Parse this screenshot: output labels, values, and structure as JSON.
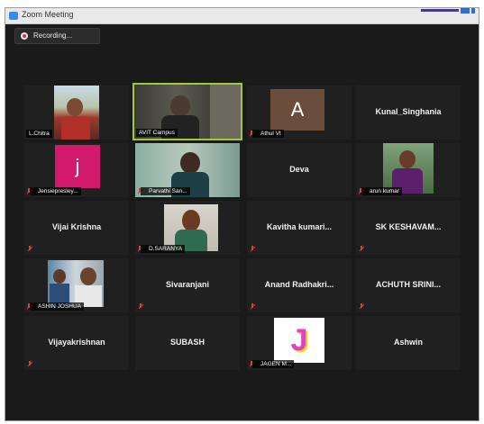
{
  "window": {
    "title": "Zoom Meeting"
  },
  "recording": {
    "label": "Recording..."
  },
  "participants": [
    {
      "name": "L.Chitra",
      "kind": "video"
    },
    {
      "name": "AVIT Campus",
      "kind": "video",
      "active": true
    },
    {
      "name": "Athul Vt",
      "kind": "letter",
      "letter": "A",
      "letter_bg": "#6a4d3b"
    },
    {
      "name": "Kunal_Singhania",
      "kind": "name"
    },
    {
      "name": "Jensiepresley...",
      "kind": "letter",
      "letter": "j",
      "letter_bg": "#d11a6b"
    },
    {
      "name": "Parvathi San...",
      "kind": "video"
    },
    {
      "name": "Deva",
      "kind": "name"
    },
    {
      "name": "arun kumar",
      "kind": "video"
    },
    {
      "name": "Vijai Krishna",
      "kind": "name"
    },
    {
      "name": "D.SARANYA",
      "kind": "video"
    },
    {
      "name": "Kavitha kumari...",
      "kind": "name"
    },
    {
      "name": "SK KESHAVAM...",
      "kind": "name"
    },
    {
      "name": "ASHIN JOSHUA",
      "kind": "video"
    },
    {
      "name": "Sivaranjani",
      "kind": "name"
    },
    {
      "name": "Anand Radhakri...",
      "kind": "name"
    },
    {
      "name": "ACHUTH SRINI...",
      "kind": "name"
    },
    {
      "name": "Vijayakrishnan",
      "kind": "name"
    },
    {
      "name": "SUBASH",
      "kind": "name"
    },
    {
      "name": "JAGEN M...",
      "kind": "letter",
      "letter": "J",
      "letter_bg": "#e040c8"
    },
    {
      "name": "Ashwin",
      "kind": "name"
    }
  ],
  "colors": {
    "active_border": "#a4c639",
    "mute": "#e23b3b",
    "tile": "#202020",
    "stage": "#1a1a1a"
  }
}
